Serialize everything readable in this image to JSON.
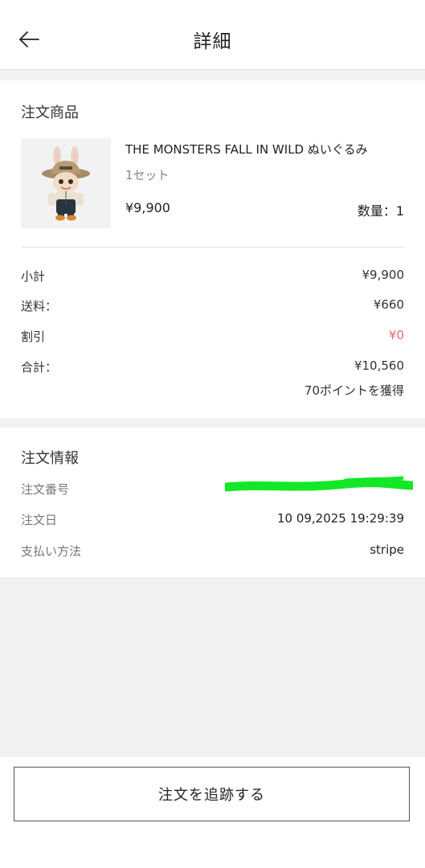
{
  "header": {
    "title": "詳細"
  },
  "order_items": {
    "section_title": "注文商品",
    "product": {
      "name": "THE MONSTERS FALL IN WILD ぬいぐるみ",
      "variant": "1セット",
      "price": "¥9,900",
      "quantity": "数量：1"
    },
    "summary": {
      "subtotal_label": "小計",
      "subtotal_value": "¥9,900",
      "shipping_label": "送料：",
      "shipping_value": "¥660",
      "discount_label": "割引",
      "discount_value": "¥0",
      "total_label": "合計：",
      "total_value": "¥10,560",
      "points": "70ポイントを獲得"
    }
  },
  "order_info": {
    "section_title": "注文情報",
    "order_number_label": "注文番号",
    "order_date_label": "注文日",
    "order_date_value": "10 09,2025 19:29:39",
    "payment_label": "支払い方法",
    "payment_value": "stripe"
  },
  "footer": {
    "track_button": "注文を追跡する"
  },
  "colors": {
    "discount_red": "#e26b6b",
    "redaction_green": "#12e826"
  }
}
